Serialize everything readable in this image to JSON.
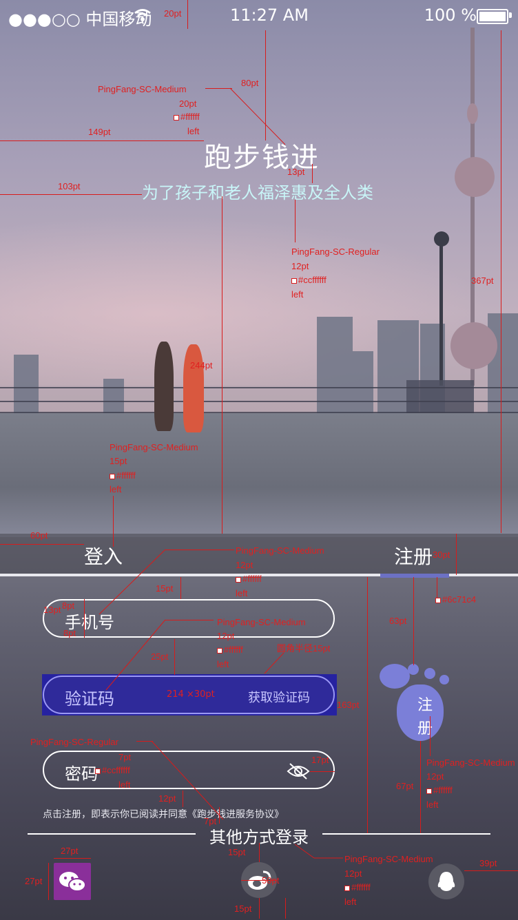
{
  "status_bar": {
    "carrier": "●●●○○ 中国移动",
    "time": "11:27 AM",
    "battery": "100 %"
  },
  "app": {
    "title": "跑步钱进",
    "subtitle": "为了孩子和老人福泽惠及全人类"
  },
  "tabs": [
    {
      "label": "登入"
    },
    {
      "label": "注册"
    }
  ],
  "form": {
    "phone_label": "手机号",
    "code_label": "验证码",
    "code_size_note": "214 ×30pt",
    "get_code": "获取验证码",
    "password_label": "密码",
    "agreement": "点击注册，即表示你已阅读并同意《跑步钱进服务协议》"
  },
  "register_button": {
    "line1": "注",
    "line2": "册"
  },
  "other_login": {
    "label": "其他方式登录"
  },
  "social": [
    {
      "icon": "wechat-icon"
    },
    {
      "icon": "weibo-icon"
    },
    {
      "icon": "qq-icon"
    }
  ],
  "colors": {
    "accent": "#6c71c4",
    "annotation": "#e02020",
    "subtitle": "#ccffff"
  },
  "annotations": {
    "a01": "20pt",
    "a02": "PingFang-SC-Medium",
    "a03": "20pt",
    "a04": "#ffffff",
    "a05": "left",
    "a06": "80pt",
    "a07": "149pt",
    "a08": "13pt",
    "a09": "103pt",
    "a10": "PingFang-SC-Regular",
    "a11": "12pt",
    "a12": "#ccffffff",
    "a13": "left",
    "a14": "367pt",
    "a15": "244pt",
    "a16": "PingFang-SC-Medium",
    "a17": "15pt",
    "a18": "#ffffff",
    "a19": "left",
    "a20": "60pt",
    "a21": "PingFang-SC-Medium",
    "a22": "12pt",
    "a23": "#ffffff",
    "a24": "left",
    "a25": "30pt",
    "a26": "#6c71c4",
    "a27": "15pt",
    "a28": "13pt",
    "a29": "8pt",
    "a30": "8pt",
    "a31": "PingFang-SC-Medium",
    "a32": "12pt",
    "a33": "#ffffff",
    "a34": "left",
    "a35": "圆角半径15pt",
    "a36": "25pt",
    "a37": "63pt",
    "a38": "163pt",
    "a39": "PingFang-SC-Medium",
    "a40": "12pt",
    "a41": "#ffffff",
    "a42": "left",
    "a43": "PingFang-SC-Regular",
    "a44": "7pt",
    "a45": "#ccffffff",
    "a46": "left",
    "a47": "17pt",
    "a48": "67pt",
    "a49": "12pt",
    "a50": "7pt",
    "a51": "27pt",
    "a52": "27pt",
    "a53": "15pt",
    "a54": "50pt",
    "a55": "15pt",
    "a56": "PingFang-SC-Medium",
    "a57": "12pt",
    "a58": "#ffffff",
    "a59": "left",
    "a60": "39pt"
  }
}
